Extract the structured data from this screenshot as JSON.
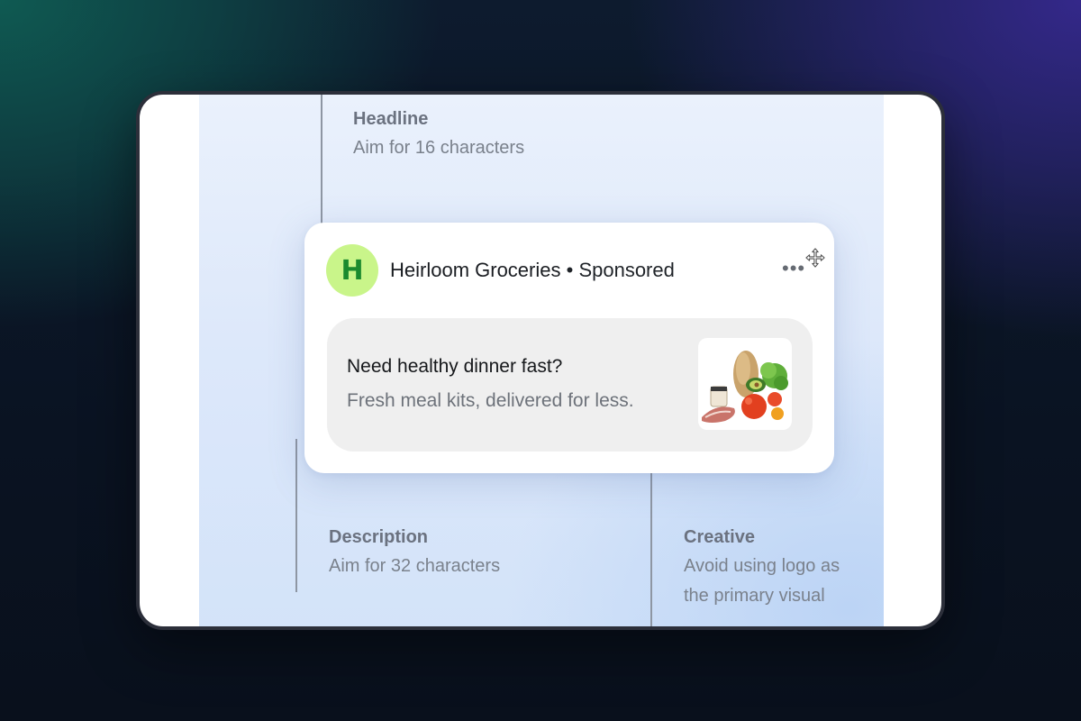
{
  "annotations": {
    "headline": {
      "title": "Headline",
      "text": "Aim for 16 characters"
    },
    "description": {
      "title": "Description",
      "text": "Aim for 32 characters"
    },
    "creative": {
      "title": "Creative",
      "line1": "Avoid using logo as",
      "line2": "the primary visual"
    }
  },
  "ad": {
    "logo_letter": "H",
    "brand": "Heirloom Groceries",
    "separator": " • ",
    "sponsored": "Sponsored",
    "more_label": "•••",
    "headline": "Need healthy dinner fast?",
    "description": "Fresh meal kits, delivered for less.",
    "creative_icon": "grocery-produce-image"
  },
  "colors": {
    "logo_bg": "#c9f58a",
    "logo_letter": "#1a8a2e",
    "panel_bg": "#dde8fa",
    "card_body": "#efefef"
  }
}
